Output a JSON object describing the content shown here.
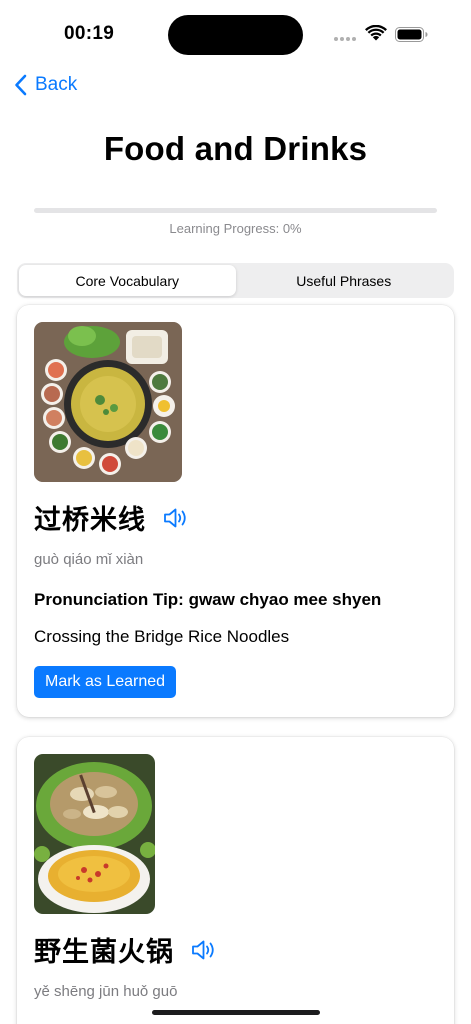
{
  "status_bar": {
    "time": "00:19",
    "icons": [
      "signal-dots-icon",
      "wifi-icon",
      "battery-icon"
    ]
  },
  "nav": {
    "back_label": "Back",
    "back_icon": "chevron-left-icon"
  },
  "page": {
    "title": "Food and Drinks"
  },
  "progress": {
    "label": "Learning Progress: 0%",
    "value_percent": 0
  },
  "tabs": [
    {
      "label": "Core Vocabulary",
      "selected": true
    },
    {
      "label": "Useful Phrases",
      "selected": false
    }
  ],
  "cards": [
    {
      "hanzi": "过桥米线",
      "pinyin": "guò qiáo mǐ xiàn",
      "tip": "Pronunciation Tip: gwaw chyao mee shyen",
      "meaning": "Crossing the Bridge Rice Noodles",
      "button_label": "Mark as Learned",
      "audio_icon": "speaker-icon"
    },
    {
      "hanzi": "野生菌火锅",
      "pinyin": "yě shēng jūn huǒ guō",
      "audio_icon": "speaker-icon"
    }
  ],
  "colors": {
    "accent": "#0a7aff",
    "secondary_text": "#7c7c80",
    "segment_bg": "#eeeeef"
  }
}
